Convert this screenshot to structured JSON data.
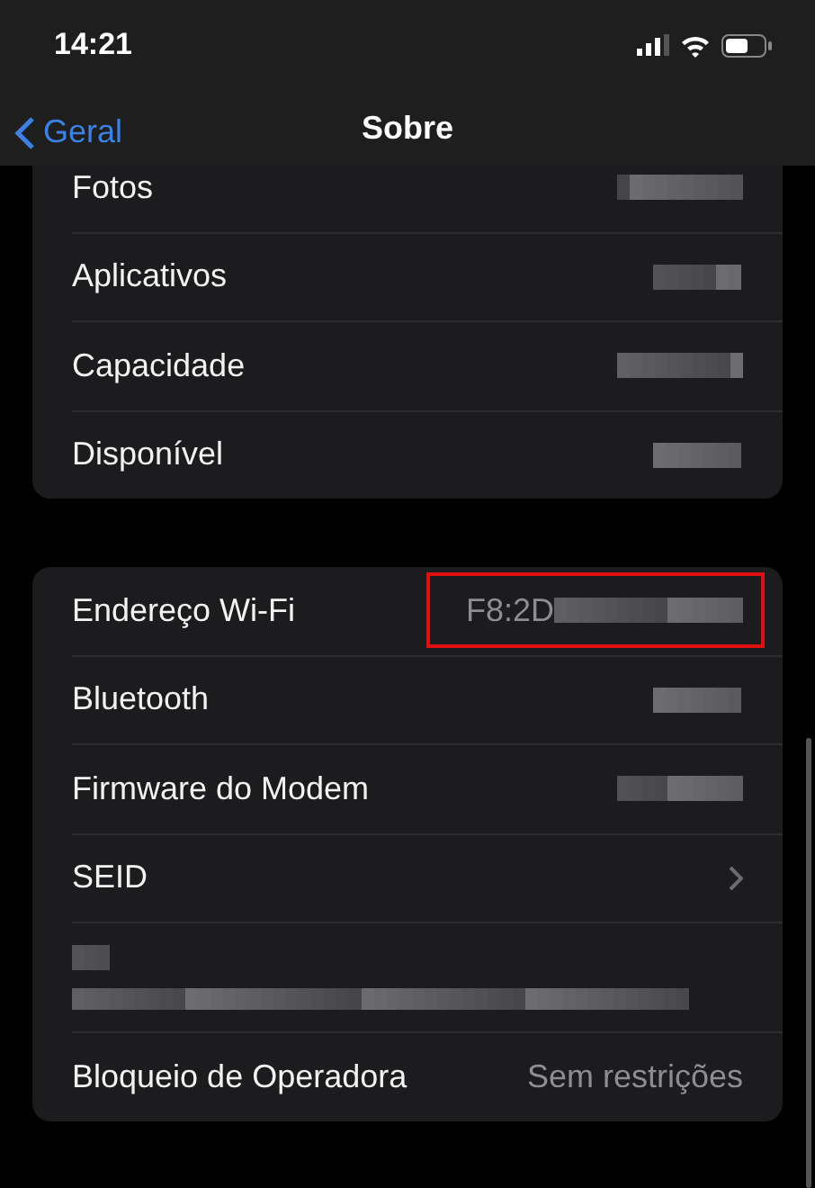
{
  "status_bar": {
    "time": "14:21"
  },
  "nav": {
    "back": "Geral",
    "title": "Sobre"
  },
  "groups": [
    {
      "rows": [
        {
          "label": "Fotos",
          "redacted": true
        },
        {
          "label": "Aplicativos",
          "redacted": true
        },
        {
          "label": "Capacidade",
          "redacted": true
        },
        {
          "label": "Disponível",
          "redacted": true
        }
      ]
    },
    {
      "rows": [
        {
          "kind": "value",
          "label": "Endereço Wi-Fi",
          "value": "F8:2D",
          "redacted": true,
          "highlighted": true
        },
        {
          "kind": "value",
          "label": "Bluetooth",
          "redacted": true,
          "highlighted": false
        },
        {
          "kind": "value",
          "label": "Firmware do Modem",
          "redacted": true,
          "highlighted": false
        },
        {
          "kind": "link",
          "label": "SEID",
          "highlighted": false
        },
        {
          "kind": "stacked",
          "redacted": true,
          "highlighted": false
        },
        {
          "kind": "value",
          "label": "Bloqueio de Operadora",
          "value": "Sem restrições",
          "highlighted": false
        }
      ]
    }
  ]
}
